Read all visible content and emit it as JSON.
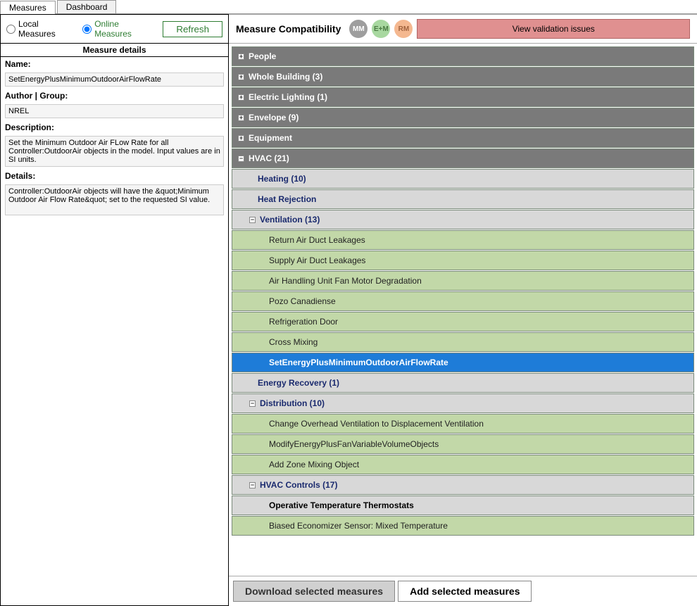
{
  "tabs": {
    "measures": "Measures",
    "dashboard": "Dashboard"
  },
  "left": {
    "local": "Local Measures",
    "online": "Online Measures",
    "refresh": "Refresh",
    "details_header": "Measure details",
    "name_label": "Name:",
    "name_value": "SetEnergyPlusMinimumOutdoorAirFlowRate",
    "author_label": "Author | Group:",
    "author_value": "NREL",
    "desc_label": "Description:",
    "desc_value": "Set the Minimum Outdoor Air FLow Rate for all Controller:OutdoorAir objects in the model. Input values are in SI units.",
    "details_label": "Details:",
    "details_value": "Controller:OutdoorAir objects will have the &quot;Minimum Outdoor Air Flow Rate&quot; set to the requested SI value."
  },
  "right": {
    "title": "Measure Compatibility",
    "badges": {
      "mm": "MM",
      "em": "E+M",
      "rm": "RM"
    },
    "validation": "View validation issues",
    "download": "Download selected measures",
    "add": "Add selected measures"
  },
  "tree": {
    "people": "People",
    "whole": "Whole Building (3)",
    "lighting": "Electric Lighting (1)",
    "envelope": "Envelope (9)",
    "equipment": "Equipment",
    "hvac": "HVAC (21)",
    "heating": "Heating (10)",
    "heatrej": "Heat Rejection",
    "vent": "Ventilation (13)",
    "v1": "Return Air Duct Leakages",
    "v2": "Supply Air Duct Leakages",
    "v3": "Air Handling Unit Fan Motor Degradation",
    "v4": "Pozo Canadiense",
    "v5": "Refrigeration Door",
    "v6": "Cross Mixing",
    "v7": "SetEnergyPlusMinimumOutdoorAirFlowRate",
    "energy": "Energy Recovery (1)",
    "dist": "Distribution (10)",
    "d1": "Change Overhead Ventilation to Displacement Ventilation",
    "d2": "ModifyEnergyPlusFanVariableVolumeObjects",
    "d3": "Add Zone Mixing Object",
    "ctrl": "HVAC Controls (17)",
    "c1": "Operative Temperature Thermostats",
    "c2": "Biased Economizer Sensor: Mixed Temperature"
  }
}
